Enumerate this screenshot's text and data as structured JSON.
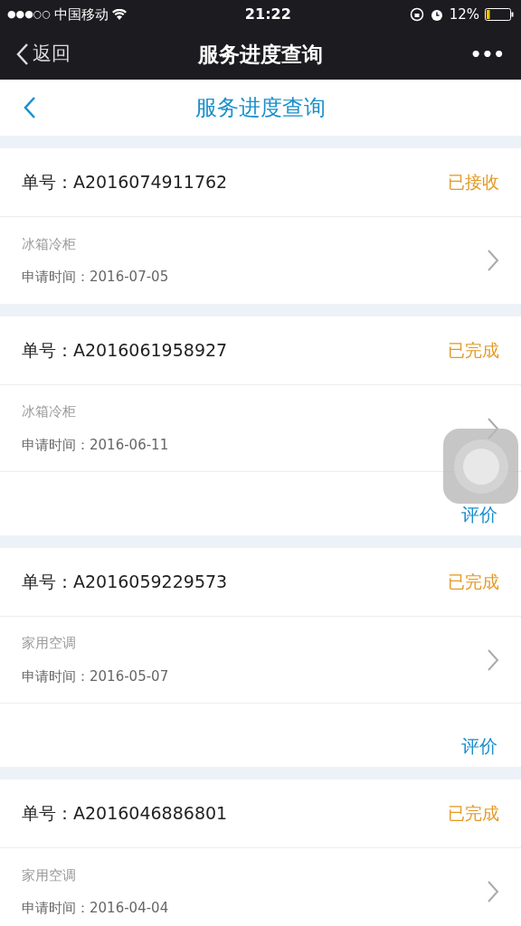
{
  "status_bar": {
    "signal": "●●●○○",
    "carrier": "中国移动",
    "time": "21:22",
    "battery": "12%"
  },
  "nav_bar": {
    "back": "返回",
    "title": "服务进度查询",
    "more": "•••"
  },
  "header": {
    "title": "服务进度查询"
  },
  "orders": [
    {
      "number": "单号：A2016074911762",
      "status": "已接收",
      "category": "冰箱冷柜",
      "date": "申请时间：2016-07-05"
    },
    {
      "number": "单号：A2016061958927",
      "status": "已完成",
      "category": "冰箱冷柜",
      "date": "申请时间：2016-06-11",
      "action": "评价"
    },
    {
      "number": "单号：A2016059229573",
      "status": "已完成",
      "category": "家用空调",
      "date": "申请时间：2016-05-07",
      "action": "评价"
    },
    {
      "number": "单号：A2016046886801",
      "status": "已完成",
      "category": "家用空调",
      "date": "申请时间：2016-04-04"
    }
  ]
}
